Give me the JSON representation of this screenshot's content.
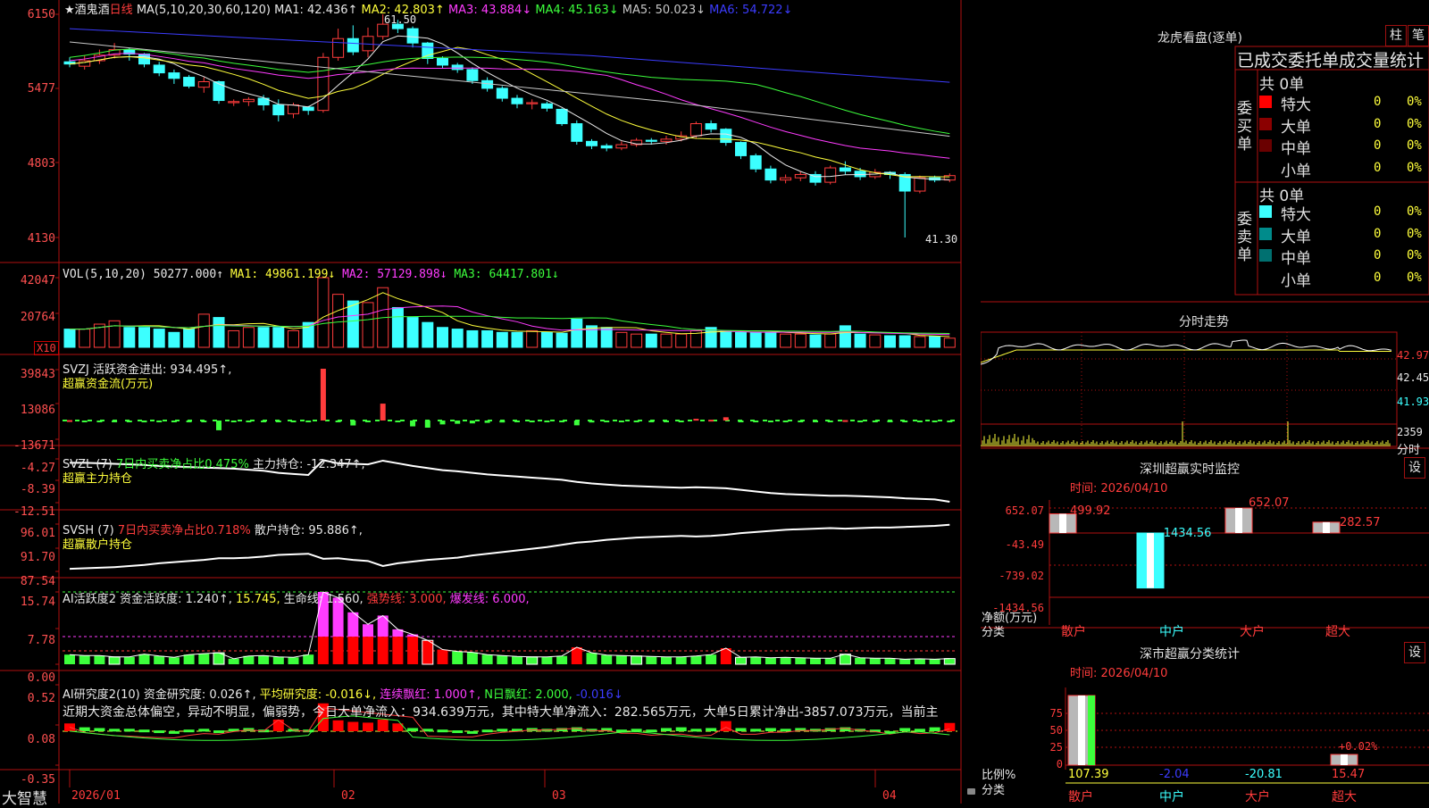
{
  "chart": {
    "stock_name": "★酒鬼酒",
    "period": "日线",
    "ma_params": "MA(5,10,20,30,60,120)",
    "ma_items": [
      {
        "label": "MA1: 42.436↑",
        "color": "#e8e8e8"
      },
      {
        "label": "MA2: 42.803↑",
        "color": "#ffff3c"
      },
      {
        "label": "MA3: 43.884↓",
        "color": "#ff3cff"
      },
      {
        "label": "MA4: 45.163↓",
        "color": "#3cff3c"
      },
      {
        "label": "MA5: 50.023↓",
        "color": "#c8c8c8"
      },
      {
        "label": "MA6: 54.722↓",
        "color": "#3c3cff"
      }
    ],
    "price_axis": [
      "6150",
      "5477",
      "4803",
      "4130"
    ],
    "high_label": "61.50",
    "low_label": "41.30",
    "vol_title": "VOL(5,10,20)",
    "vol_value": "50277.000↑",
    "vol_ma": [
      {
        "label": "MA1: 49861.199↓",
        "color": "#ffff3c"
      },
      {
        "label": "MA2: 57129.898↓",
        "color": "#ff3cff"
      },
      {
        "label": "MA3: 64417.801↓",
        "color": "#3cff3c"
      }
    ],
    "vol_axis": [
      "42047",
      "20764"
    ],
    "vol_unit": "X10",
    "svzj_title": "SVZJ",
    "svzj_label": "活跃资金进出: 934.495↑,",
    "svzj_sub": "超赢资金流(万元)",
    "svzj_axis": [
      "39843",
      "13086",
      "-13671"
    ],
    "svzl_title": "SVZL (7)",
    "svzl_ratio": "7日内买卖净占比0.475%",
    "svzl_label": "主力持仓: -12.347↑,",
    "svzl_sub": "超赢主力持仓",
    "svzl_axis": [
      "-4.27",
      "-8.39",
      "-12.51"
    ],
    "svsh_title": "SVSH (7)",
    "svsh_ratio": "7日内买卖净占比0.718%",
    "svsh_label": "散户持仓: 95.886↑,",
    "svsh_sub": "超赢散户持仓",
    "svsh_axis": [
      "96.01",
      "91.70",
      "87.54"
    ],
    "ai1_title": "AI活跃度2",
    "ai1_items": [
      {
        "label": "资金活跃度: 1.240↑,",
        "color": "#e8e8e8"
      },
      {
        "label": "15.745,",
        "color": "#ffff3c"
      },
      {
        "label": "生命线: 1.560,",
        "color": "#e8e8e8"
      },
      {
        "label": "强势线: 3.000,",
        "color": "#ff3c3c"
      },
      {
        "label": "爆发线: 6.000,",
        "color": "#ff3cff"
      }
    ],
    "ai1_axis": [
      "15.74",
      "7.78",
      "0.00"
    ],
    "ai2_title": "AI研究度2(10)",
    "ai2_items": [
      {
        "label": "资金研究度: 0.026↑,",
        "color": "#e8e8e8"
      },
      {
        "label": "平均研究度: -0.016↓,",
        "color": "#ffff3c"
      },
      {
        "label": "连续飘红: 1.000↑,",
        "color": "#ff3cff"
      },
      {
        "label": "N日飘红: 2.000,",
        "color": "#3cff3c"
      },
      {
        "label": "-0.016↓",
        "color": "#3c3cff"
      }
    ],
    "ai2_text": "近期大资金总体偏空，异动不明显，偏弱势，今日大单净流入：934.639万元，其中特大单净流入：282.565万元，大单5日累计净出-3857.073万元，当前主",
    "ai2_axis": [
      "0.52",
      "0.08",
      "-0.35"
    ],
    "x_axis": [
      "2026/01",
      "02",
      "03",
      "04"
    ],
    "brand": "大智慧"
  },
  "right": {
    "lhkp_title": "龙虎看盘(逐单)",
    "btn_zhu": "柱",
    "btn_bi": "笔",
    "stat_title": "已成交委托单成交量统计",
    "buy_label": [
      "委",
      "买",
      "单"
    ],
    "sell_label": [
      "委",
      "卖",
      "单"
    ],
    "buy_total": "共 0单",
    "sell_total": "共 0单",
    "buy_rows": [
      {
        "name": "特大",
        "val": "0",
        "pct": "0%",
        "color": "#ff0000"
      },
      {
        "name": "大单",
        "val": "0",
        "pct": "0%",
        "color": "#8b0000"
      },
      {
        "name": "中单",
        "val": "0",
        "pct": "0%",
        "color": "#6a0000"
      },
      {
        "name": "小单",
        "val": "0",
        "pct": "0%",
        "color": "#000000"
      }
    ],
    "sell_rows": [
      {
        "name": "特大",
        "val": "0",
        "pct": "0%",
        "color": "#3cffff"
      },
      {
        "name": "大单",
        "val": "0",
        "pct": "0%",
        "color": "#008b8b"
      },
      {
        "name": "中单",
        "val": "0",
        "pct": "0%",
        "color": "#007070"
      },
      {
        "name": "小单",
        "val": "0",
        "pct": "0%",
        "color": "#000000"
      }
    ],
    "fs_title": "分时走势",
    "fs_axis": [
      "42.97",
      "42.45",
      "41.93",
      "2359",
      "分时"
    ],
    "sz_title": "深圳超赢实时监控",
    "sz_time": "时间: 2026/04/10",
    "sz_axis": [
      "652.07",
      "-43.49",
      "-739.02",
      "-1434.56"
    ],
    "sz_ylabel": "净额(万元)",
    "sz_xlabel": "分类",
    "sz_values": [
      "499.92",
      "-1434.56",
      "652.07",
      "282.57"
    ],
    "sz_cats": [
      "散户",
      "中户",
      "大户",
      "超大"
    ],
    "sc_title": "深市超赢分类统计",
    "sc_time": "时间: 2026/04/10",
    "sc_axis": [
      "75",
      "50",
      "25",
      "0"
    ],
    "sc_ylabel": "比例%",
    "sc_xlabel": "分类",
    "sc_values": [
      "107.39",
      "-2.04",
      "-20.81",
      "15.47"
    ],
    "sc_annot": "+0.02%",
    "sc_cats": [
      "散户",
      "中户",
      "大户",
      "超大"
    ],
    "settings_btn": "设"
  },
  "chart_data": [
    {
      "type": "candlestick",
      "title": "酒鬼酒 日线",
      "ylim": [
        41.3,
        61.5
      ],
      "x": [
        "2026/01",
        "02",
        "03",
        "04"
      ],
      "candles": [
        [
          57.2,
          57.0,
          57.6,
          56.7
        ],
        [
          56.8,
          57.3,
          57.8,
          56.5
        ],
        [
          57.3,
          57.8,
          58.3,
          57.0
        ],
        [
          57.8,
          58.3,
          58.9,
          57.5
        ],
        [
          58.3,
          57.9,
          58.5,
          57.3
        ],
        [
          57.9,
          57.0,
          58.0,
          56.7
        ],
        [
          56.9,
          56.2,
          57.2,
          55.9
        ],
        [
          56.2,
          55.7,
          56.5,
          55.2
        ],
        [
          55.8,
          55.0,
          56.0,
          54.8
        ],
        [
          54.9,
          55.4,
          55.8,
          54.4
        ],
        [
          55.4,
          53.7,
          55.5,
          53.4
        ],
        [
          53.5,
          53.6,
          53.8,
          53.2
        ],
        [
          53.6,
          53.8,
          54.0,
          53.2
        ],
        [
          53.9,
          53.3,
          54.2,
          52.8
        ],
        [
          53.3,
          52.4,
          53.8,
          51.8
        ],
        [
          52.5,
          53.3,
          53.5,
          52.1
        ],
        [
          53.1,
          52.8,
          53.2,
          52.4
        ],
        [
          52.8,
          57.6,
          58.0,
          52.6
        ],
        [
          57.6,
          59.3,
          60.2,
          57.3
        ],
        [
          59.3,
          58.1,
          60.5,
          57.8
        ],
        [
          58.2,
          59.5,
          60.3,
          57.6
        ],
        [
          59.5,
          60.6,
          61.5,
          59.2
        ],
        [
          60.6,
          60.2,
          61.0,
          59.8
        ],
        [
          60.2,
          58.9,
          60.4,
          58.5
        ],
        [
          58.9,
          57.5,
          59.0,
          57.0
        ],
        [
          57.5,
          56.9,
          57.7,
          56.6
        ],
        [
          56.9,
          56.5,
          57.1,
          56.2
        ],
        [
          56.5,
          55.5,
          56.7,
          55.2
        ],
        [
          55.5,
          54.8,
          55.8,
          54.5
        ],
        [
          54.8,
          53.9,
          55.0,
          53.6
        ],
        [
          53.9,
          53.4,
          54.2,
          53.0
        ],
        [
          53.4,
          53.5,
          53.8,
          52.9
        ],
        [
          53.4,
          53.0,
          53.6,
          52.7
        ],
        [
          52.9,
          51.6,
          53.0,
          51.4
        ],
        [
          51.6,
          50.0,
          51.9,
          49.7
        ],
        [
          50.0,
          49.6,
          50.2,
          49.3
        ],
        [
          49.6,
          49.4,
          49.8,
          49.1
        ],
        [
          49.4,
          49.7,
          50.0,
          49.2
        ],
        [
          49.7,
          50.1,
          50.3,
          49.5
        ],
        [
          50.1,
          50.0,
          50.3,
          49.7
        ],
        [
          50.0,
          50.2,
          50.5,
          49.7
        ],
        [
          50.2,
          50.5,
          50.9,
          50.0
        ],
        [
          50.5,
          51.6,
          51.8,
          50.3
        ],
        [
          51.6,
          51.1,
          51.9,
          50.8
        ],
        [
          51.1,
          49.9,
          51.2,
          49.6
        ],
        [
          49.9,
          48.7,
          50.0,
          48.4
        ],
        [
          48.7,
          47.5,
          48.9,
          47.2
        ],
        [
          47.5,
          46.5,
          47.8,
          46.2
        ],
        [
          46.5,
          46.7,
          47.0,
          46.2
        ],
        [
          46.7,
          47.0,
          47.3,
          46.4
        ],
        [
          47.0,
          46.3,
          47.3,
          46.0
        ],
        [
          46.3,
          47.6,
          47.8,
          46.1
        ],
        [
          47.6,
          47.3,
          48.2,
          47.0
        ],
        [
          47.3,
          46.8,
          47.6,
          46.5
        ],
        [
          46.8,
          47.2,
          47.5,
          46.6
        ],
        [
          47.2,
          47.0,
          47.3,
          46.6
        ],
        [
          47.0,
          45.5,
          47.2,
          41.3
        ],
        [
          45.5,
          46.7,
          46.9,
          45.3
        ],
        [
          46.7,
          46.5,
          46.9,
          46.3
        ],
        [
          46.5,
          46.9,
          47.1,
          46.3
        ]
      ]
    },
    {
      "type": "bar",
      "title": "VOL(5,10,20)",
      "ylim": [
        0,
        42047
      ],
      "values": [
        11000,
        11000,
        14000,
        16000,
        12000,
        12000,
        11000,
        9000,
        11000,
        20000,
        18000,
        10000,
        12000,
        12000,
        12000,
        10000,
        15000,
        42047,
        32000,
        28000,
        27000,
        36000,
        24000,
        18000,
        15000,
        12000,
        11000,
        10000,
        10000,
        9000,
        9000,
        10000,
        9000,
        8500,
        17000,
        13000,
        12000,
        9000,
        8000,
        8000,
        8000,
        8000,
        10000,
        12000,
        10000,
        9000,
        9000,
        9000,
        8000,
        8000,
        7500,
        8000,
        13000,
        8000,
        7500,
        7000,
        7000,
        6500,
        6500,
        5500
      ]
    },
    {
      "type": "bar",
      "title": "SVZJ 活跃资金进出",
      "ylim": [
        -13671,
        39843
      ],
      "values": [
        300,
        -1200,
        -900,
        -900,
        -800,
        -1400,
        -1300,
        -1200,
        -900,
        -1200,
        -7500,
        -500,
        -1100,
        -800,
        -1200,
        -900,
        -500,
        39843,
        -400,
        -3800,
        -800,
        13000,
        -800,
        -4500,
        -5500,
        -3000,
        -2500,
        -2200,
        -1800,
        -1500,
        -1300,
        -1400,
        -1000,
        -1200,
        -3700,
        -1500,
        -1200,
        -1000,
        -1100,
        -1000,
        -800,
        -700,
        1300,
        600,
        2500,
        -600,
        -1000,
        -500,
        -800,
        -600,
        -500,
        -400,
        300,
        -800,
        -500,
        -700,
        -300,
        -500,
        -400,
        -500
      ]
    },
    {
      "type": "line",
      "title": "SVZL 主力持仓",
      "ylim": [
        -12.51,
        -4.27
      ],
      "values": [
        -5.0,
        -5.0,
        -5.1,
        -5.2,
        -5.3,
        -5.4,
        -5.6,
        -5.7,
        -5.8,
        -5.9,
        -6.0,
        -6.1,
        -6.3,
        -6.5,
        -6.9,
        -7.1,
        -7.3,
        -4.5,
        -5.1,
        -5.2,
        -5.3,
        -4.6,
        -5.1,
        -5.6,
        -6.0,
        -6.4,
        -6.6,
        -6.9,
        -7.2,
        -7.4,
        -7.6,
        -7.8,
        -8.0,
        -8.2,
        -8.6,
        -8.9,
        -9.1,
        -9.3,
        -9.4,
        -9.5,
        -9.6,
        -9.7,
        -9.6,
        -9.7,
        -9.8,
        -10.1,
        -10.4,
        -10.7,
        -10.9,
        -11.0,
        -11.1,
        -11.2,
        -11.2,
        -11.3,
        -11.4,
        -11.5,
        -11.7,
        -11.8,
        -11.9,
        -12.347
      ]
    },
    {
      "type": "line",
      "title": "SVSH 散户持仓",
      "ylim": [
        87.54,
        96.01
      ],
      "values": [
        88.0,
        88.1,
        88.2,
        88.3,
        88.5,
        88.7,
        89.0,
        89.2,
        89.4,
        89.6,
        89.9,
        89.9,
        90.0,
        90.2,
        90.5,
        90.6,
        90.7,
        89.8,
        89.9,
        89.6,
        89.4,
        88.5,
        89.0,
        89.3,
        89.6,
        89.8,
        90.0,
        90.4,
        90.7,
        91.0,
        91.3,
        91.6,
        91.9,
        92.3,
        92.7,
        92.9,
        93.2,
        93.4,
        93.6,
        93.7,
        93.8,
        93.9,
        93.8,
        93.9,
        94.1,
        94.4,
        94.6,
        94.8,
        95.0,
        95.1,
        95.2,
        95.3,
        95.2,
        95.3,
        95.4,
        95.4,
        95.5,
        95.6,
        95.7,
        95.886
      ]
    },
    {
      "type": "bar",
      "title": "AI活跃度2",
      "ylim": [
        0,
        15.74
      ],
      "values": [
        2.1,
        1.9,
        1.9,
        1.6,
        1.6,
        2.2,
        1.8,
        1.5,
        2.1,
        2.3,
        2.5,
        1.2,
        1.8,
        1.9,
        1.6,
        1.5,
        2.1,
        15.74,
        14.5,
        11.3,
        8.7,
        10.6,
        7.6,
        6.5,
        5.2,
        3.2,
        2.8,
        2.6,
        2.1,
        1.9,
        1.7,
        1.6,
        1.6,
        1.8,
        3.7,
        2.5,
        2.0,
        1.9,
        1.8,
        1.7,
        1.6,
        1.6,
        1.8,
        2.1,
        3.5,
        1.5,
        1.6,
        1.4,
        1.5,
        1.4,
        1.3,
        1.3,
        2.2,
        1.4,
        1.3,
        1.3,
        1.1,
        1.2,
        1.1,
        1.24
      ]
    },
    {
      "type": "bar",
      "title": "AI研究度2(10)",
      "ylim": [
        -0.35,
        0.52
      ],
      "values": [
        0.02,
        -0.03,
        -0.04,
        -0.05,
        -0.05,
        -0.06,
        -0.07,
        -0.08,
        -0.06,
        -0.05,
        -0.07,
        -0.05,
        -0.04,
        -0.06,
        0.07,
        -0.05,
        -0.06,
        0.28,
        0.06,
        0.04,
        0.03,
        0.07,
        0.02,
        -0.04,
        -0.05,
        -0.06,
        -0.07,
        -0.08,
        -0.06,
        -0.05,
        -0.05,
        -0.04,
        -0.05,
        -0.04,
        -0.03,
        -0.05,
        -0.04,
        -0.06,
        -0.05,
        -0.06,
        -0.04,
        -0.03,
        -0.05,
        -0.04,
        0.05,
        -0.04,
        -0.05,
        -0.04,
        -0.05,
        -0.04,
        -0.05,
        -0.04,
        -0.03,
        -0.05,
        -0.06,
        -0.08,
        -0.04,
        -0.05,
        -0.03,
        0.026
      ]
    },
    {
      "type": "bar",
      "title": "深圳超赢实时监控",
      "categories": [
        "散户",
        "中户",
        "大户",
        "超大"
      ],
      "values": [
        499.92,
        -1434.56,
        652.07,
        282.57
      ],
      "ylabel": "净额(万元)",
      "ylim": [
        -1434.56,
        652.07
      ]
    },
    {
      "type": "bar",
      "title": "深市超赢分类统计",
      "categories": [
        "散户",
        "中户",
        "大户",
        "超大"
      ],
      "values": [
        107.39,
        -2.04,
        -20.81,
        15.47
      ],
      "ylabel": "比例%",
      "ylim": [
        0,
        75
      ]
    }
  ]
}
